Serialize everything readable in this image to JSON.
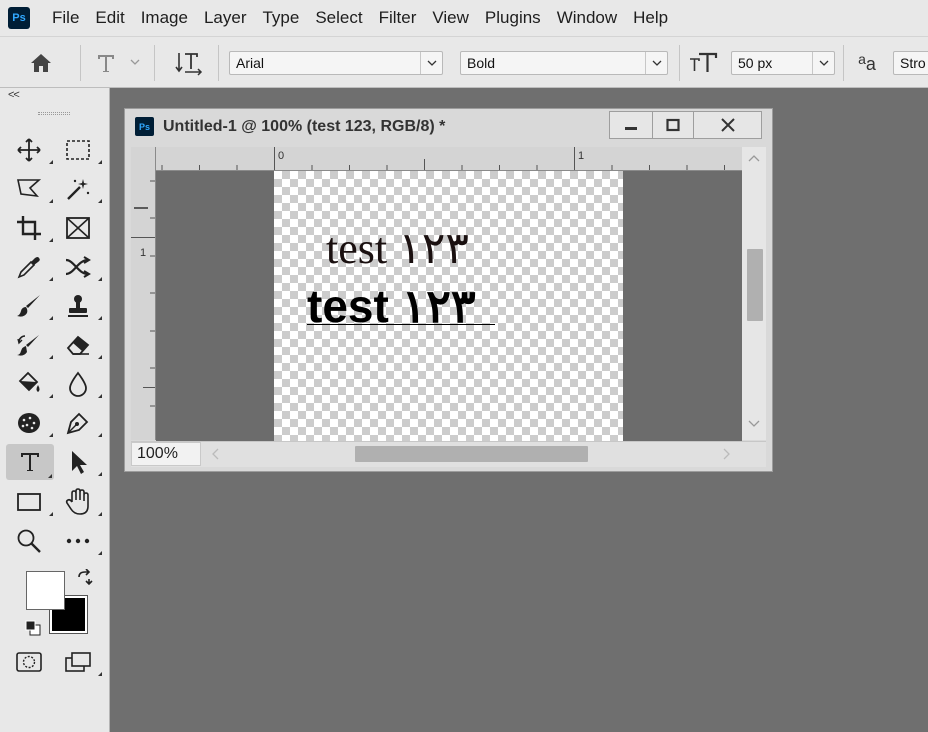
{
  "app": {
    "logo": "Ps"
  },
  "menu": [
    "File",
    "Edit",
    "Image",
    "Layer",
    "Type",
    "Select",
    "Filter",
    "View",
    "Plugins",
    "Window",
    "Help"
  ],
  "options": {
    "font_family": "Arial",
    "font_style": "Bold",
    "font_size": "50 px",
    "antialias_glyph": "a",
    "antialias_glyph_b": "a",
    "antialias_value": "Stro"
  },
  "toolbar": {
    "collapse": "<<"
  },
  "document": {
    "title": "Untitled-1 @ 100% (test 123, RGB/8) *",
    "line1": "test ١٢٣",
    "line2": "test ١٢٣",
    "zoom": "100%",
    "ruler_top_labels": [
      "0",
      "1"
    ],
    "ruler_left_labels": [
      "1"
    ]
  },
  "colors": {
    "foreground": "#ffffff",
    "background": "#000000",
    "workspace": "#6f6f6f",
    "chrome": "#e8e8e8"
  }
}
